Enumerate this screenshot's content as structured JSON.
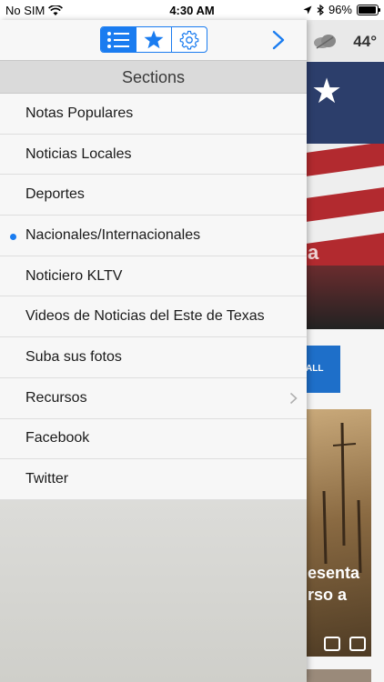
{
  "status_bar": {
    "carrier": "No SIM",
    "time": "4:30 AM",
    "battery_percent": "96%",
    "battery_level": 0.96
  },
  "background": {
    "weather_temp": "44°",
    "flag_overlay_text": "a",
    "banner_text": "ALL",
    "photo_caption_line1": "esenta",
    "photo_caption_line2": "rso a"
  },
  "toolbar": {
    "tabs": [
      {
        "name": "list",
        "icon": "list-icon",
        "active": true
      },
      {
        "name": "favorites",
        "icon": "star-icon",
        "active": false
      },
      {
        "name": "settings",
        "icon": "gear-icon",
        "active": false
      }
    ],
    "accent_color": "#1a7cf0",
    "close_icon": "chevron-right-icon"
  },
  "sections": {
    "title": "Sections",
    "items": [
      {
        "label": "Notas Populares",
        "selected": false,
        "has_children": false
      },
      {
        "label": "Noticias Locales",
        "selected": false,
        "has_children": false
      },
      {
        "label": "Deportes",
        "selected": false,
        "has_children": false
      },
      {
        "label": "Nacionales/Internacionales",
        "selected": true,
        "has_children": false
      },
      {
        "label": "Noticiero KLTV",
        "selected": false,
        "has_children": false
      },
      {
        "label": "Videos de Noticias del Este de Texas",
        "selected": false,
        "has_children": false
      },
      {
        "label": "Suba sus fotos",
        "selected": false,
        "has_children": false
      },
      {
        "label": "Recursos",
        "selected": false,
        "has_children": true
      },
      {
        "label": "Facebook",
        "selected": false,
        "has_children": false
      },
      {
        "label": "Twitter",
        "selected": false,
        "has_children": false
      }
    ]
  }
}
